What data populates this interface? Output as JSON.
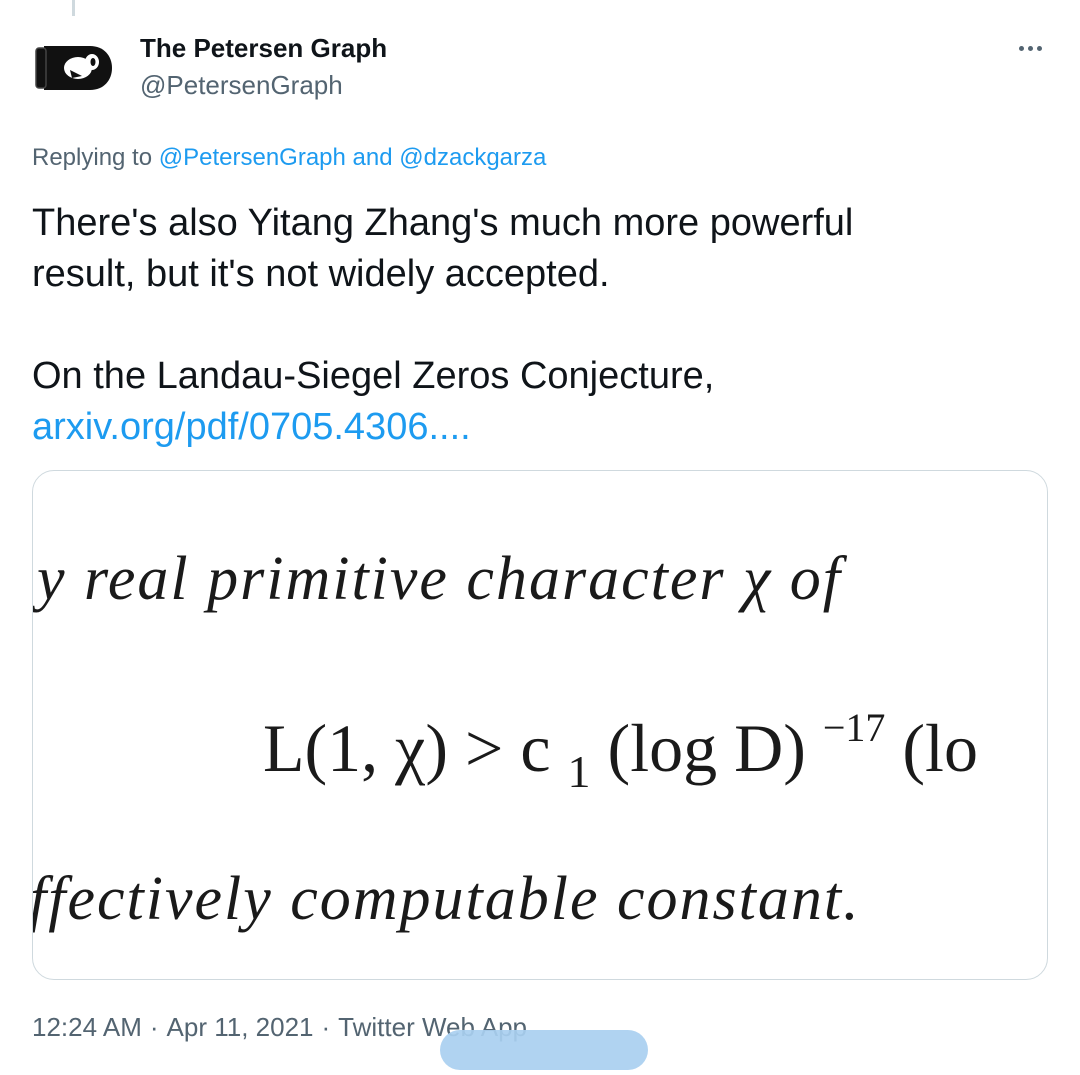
{
  "thread": {
    "connector": true
  },
  "author": {
    "display_name": "The Petersen Graph",
    "handle": "@PetersenGraph",
    "avatar_icon": "bullet-bill-icon"
  },
  "more_icon": "more-horizontal-icon",
  "reply": {
    "prefix": "Replying to",
    "mention_1": "@PetersenGraph",
    "joiner": "and",
    "mention_2": "@dzackgarza"
  },
  "tweet": {
    "line_1": "There's also Yitang Zhang's much more powerful",
    "line_2": "result, but it's not widely accepted.",
    "line_3": "On the Landau-Siegel Zeros Conjecture,",
    "link_text": "arxiv.org/pdf/0705.4306...."
  },
  "media": {
    "line_1": "y real primitive character χ of",
    "formula_main": "L(1, χ) > c",
    "formula_subscript": "1",
    "formula_log": "(log D)",
    "formula_exponent": "−17",
    "formula_tail": "(lo",
    "line_3": "ffectively computable constant."
  },
  "meta": {
    "time": "12:24 AM",
    "date": "Apr 11, 2021",
    "source": "Twitter Web App",
    "separator": "·"
  },
  "colors": {
    "link": "#1d9bf0",
    "secondary_text": "#536471",
    "primary_text": "#0f1419",
    "border": "#cfd9de",
    "redaction": "#a9cff0"
  }
}
